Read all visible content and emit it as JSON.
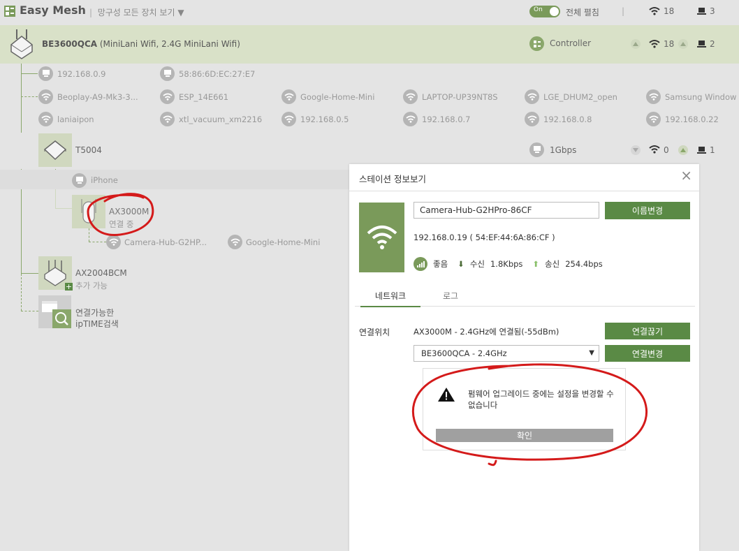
{
  "app": {
    "title": "Easy Mesh",
    "view_all": "망구성 모든 장치 보기",
    "toggle_on": "On",
    "expand_all": "전체 펼침",
    "wifi_count": "18",
    "wired_count": "3"
  },
  "controller": {
    "model": "BE3600QCA",
    "ssids": " (MiniLani Wifi, 2.4G MiniLani Wifi)",
    "role": "Controller",
    "wifi_count": "18",
    "wired_count": "2"
  },
  "clients_wired": [
    "192.168.0.9",
    "58:86:6D:EC:27:E7"
  ],
  "clients_wifi_row1": [
    "Beoplay-A9-Mk3-3...",
    "ESP_14E661",
    "Google-Home-Mini",
    "LAPTOP-UP39NT8S",
    "LGE_DHUM2_open",
    "Samsung Window ..."
  ],
  "clients_wifi_row2": [
    "laniaipon",
    "xtl_vacuum_xm2216",
    "192.168.0.5",
    "192.168.0.7",
    "192.168.0.8",
    "192.168.0.22"
  ],
  "t5004": {
    "name": "T5004",
    "speed": "1Gbps",
    "wifi_count": "0",
    "wired_count": "1"
  },
  "iphone": {
    "name": "iPhone"
  },
  "ax3000m": {
    "name": "AX3000M",
    "status": "연결 중"
  },
  "ax3000m_clients": [
    "Camera-Hub-G2HP...",
    "Google-Home-Mini"
  ],
  "ax2004bcm": {
    "name": "AX2004BCM",
    "status": "추가 가능"
  },
  "search": {
    "line1": "연결가능한",
    "line2": "ipTIME검색"
  },
  "dialog": {
    "title": "스테이션 정보보기",
    "close": "×",
    "device_name": "Camera-Hub-G2HPro-86CF",
    "rename_button": "이름변경",
    "ip_mac": "192.168.0.19 ( 54:EF:44:6A:86:CF )",
    "signal": "좋음",
    "rx_label": "수신",
    "rx_value": "1.8Kbps",
    "tx_label": "송신",
    "tx_value": "254.4bps",
    "tab_network": "네트워크",
    "tab_log": "로그",
    "conn_label": "연결위치",
    "conn_value": "AX3000M - 2.4GHz에 연결됨(-55dBm)",
    "disconnect_button": "연결끊기",
    "select_value": "BE3600QCA - 2.4GHz",
    "change_button": "연결변경"
  },
  "alert": {
    "message": "펌웨어 업그레이드 중에는 설정을 변경할 수 없습니다",
    "confirm": "확인"
  },
  "colors": {
    "accent": "#5a8a45",
    "tile": "#7a9a5a",
    "annotation": "#d41a1a"
  }
}
